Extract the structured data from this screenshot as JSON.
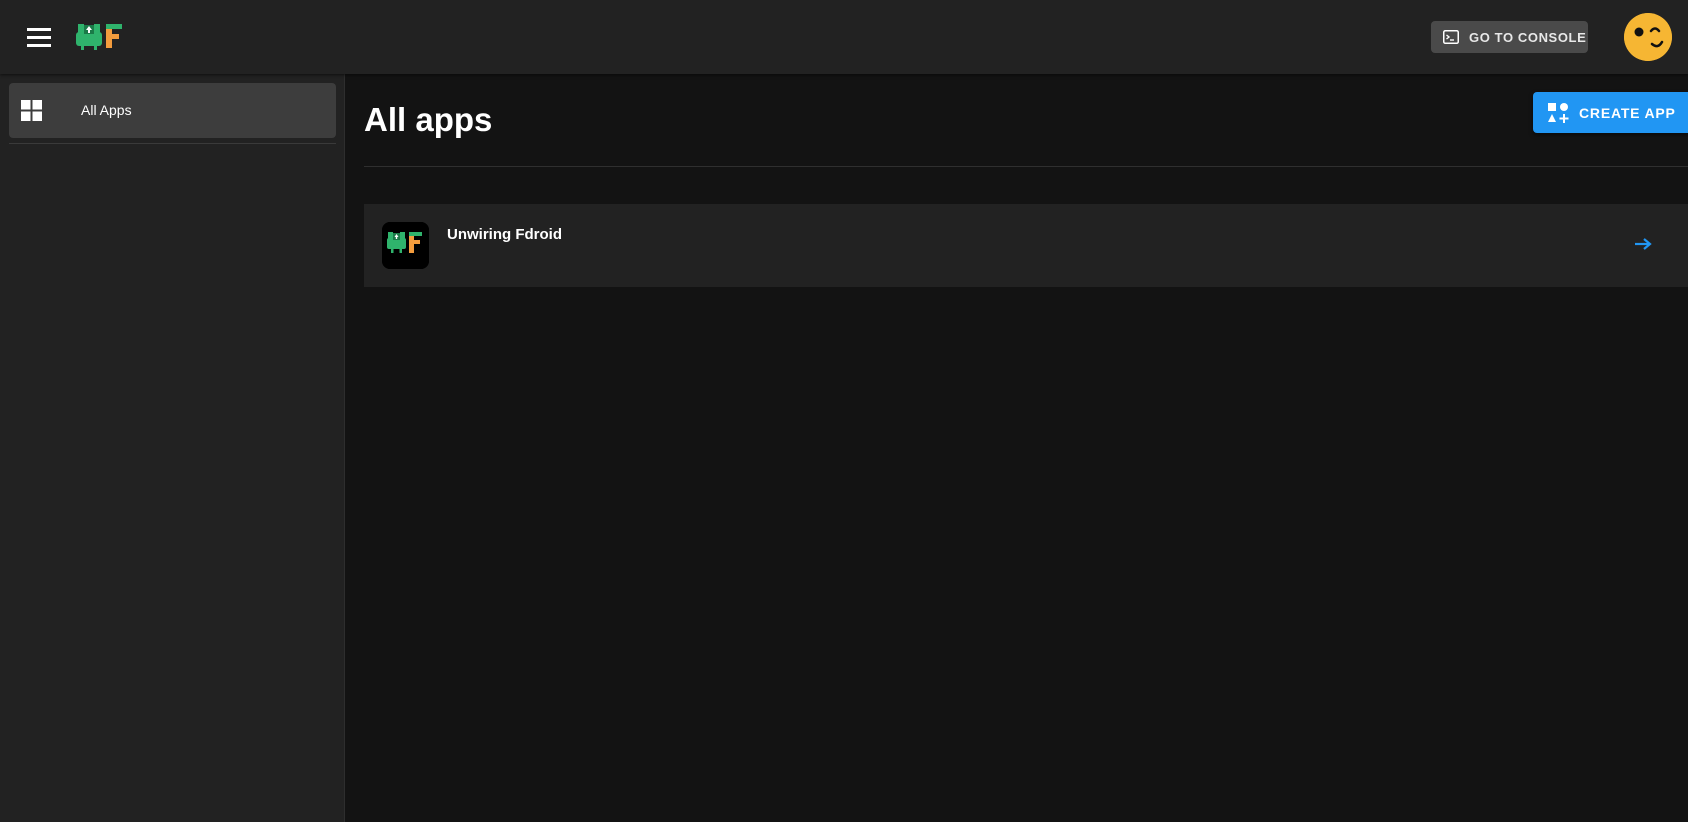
{
  "header": {
    "console_label": "GO TO CONSOLE",
    "menu_icon": "hamburger-menu-icon",
    "logo_icon": "uf-logo-icon",
    "avatar_icon": "winking-face-avatar-icon"
  },
  "sidebar": {
    "items": [
      {
        "label": "All Apps",
        "icon": "apps-grid-icon",
        "active": true
      }
    ]
  },
  "main": {
    "title": "All apps",
    "create_label": "CREATE APP",
    "apps": [
      {
        "name": "Unwiring Fdroid",
        "icon": "uf-app-icon"
      }
    ]
  },
  "colors": {
    "accent": "#2196f3",
    "header_bg": "#222222",
    "page_bg": "#131313",
    "logo_green": "#2fb36c",
    "logo_orange": "#f39c3d",
    "avatar": "#f6b633"
  }
}
